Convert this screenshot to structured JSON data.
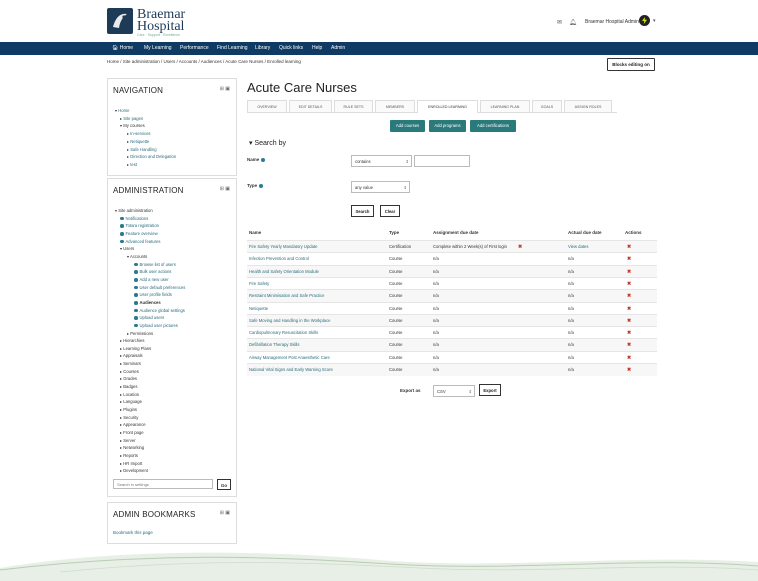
{
  "site": {
    "name_line1": "Braemar",
    "name_line2": "Hospital",
    "tagline": "Care · Support · Excellence"
  },
  "header": {
    "user_name": "Braemar Hospital Admin",
    "mail_icon": "envelope-icon",
    "bell_icon": "bell-icon"
  },
  "nav": {
    "items": [
      "Home",
      "My Learning",
      "Performance",
      "Find Learning",
      "Library",
      "Quick links",
      "Help",
      "Admin"
    ]
  },
  "breadcrumb": "Home / Site administration / Users / Accounts / Audiences / Acute Care Nurses / Enrolled learning",
  "blocks_editing_label": "Blocks editing on",
  "navigation_block": {
    "title": "NAVIGATION",
    "items": [
      "Home",
      "Site pages",
      "My courses",
      "In-services",
      "Netiquette",
      "Safe Handling",
      "Direction and Delegation",
      "test"
    ]
  },
  "admin_block": {
    "title": "ADMINISTRATION",
    "items": [
      "Site administration",
      "Notifications",
      "Totara registration",
      "Feature overview",
      "Advanced features",
      "Users",
      "Accounts",
      "Browse list of users",
      "Bulk user actions",
      "Add a new user",
      "User default preferences",
      "User profile fields",
      "Audiences",
      "Audience global settings",
      "Upload users",
      "Upload user pictures",
      "Permissions",
      "Hierarchies",
      "Learning Plans",
      "Appraisals",
      "Seminars",
      "Courses",
      "Grades",
      "Badges",
      "Location",
      "Language",
      "Plugins",
      "Security",
      "Appearance",
      "Front page",
      "Server",
      "Networking",
      "Reports",
      "HR Import",
      "Development"
    ],
    "search_placeholder": "Search in settings",
    "go_label": "Go"
  },
  "bookmarks_block": {
    "title": "ADMIN BOOKMARKS",
    "link": "Bookmark this page"
  },
  "main": {
    "title": "Acute Care Nurses",
    "tabs": [
      "OVERVIEW",
      "EDIT DETAILS",
      "RULE SETS",
      "MEMBERS",
      "ENROLLED LEARNING",
      "LEARNING PLAN",
      "GOALS",
      "ASSIGN ROLES"
    ],
    "active_tab": "ENROLLED LEARNING",
    "buttons": [
      "Add courses",
      "Add programs",
      "Add certifications"
    ],
    "search_by": "Search by",
    "name_label": "Name",
    "name_operator": "contains",
    "type_label": "Type",
    "type_value": "any value",
    "search_button": "Search",
    "clear_button": "Clear",
    "table": {
      "headers": [
        "Name",
        "Type",
        "Assignment due date",
        "Actual due date",
        "Actions"
      ],
      "rows": [
        [
          "Fire Safety Yearly Mandatory Update",
          "Certification",
          "Complete within 2 Week(s) of First login",
          "View dates"
        ],
        [
          "Infection Prevention and Control",
          "Course",
          "n/a",
          "n/a"
        ],
        [
          "Health and Safety Orientation Module",
          "Course",
          "n/a",
          "n/a"
        ],
        [
          "Fire Safety",
          "Course",
          "n/a",
          "n/a"
        ],
        [
          "Restraint Minimisation and Safe Practice",
          "Course",
          "n/a",
          "n/a"
        ],
        [
          "Netiquette",
          "Course",
          "n/a",
          "n/a"
        ],
        [
          "Safe Moving and Handling in the Workplace",
          "Course",
          "n/a",
          "n/a"
        ],
        [
          "Cardiopulmonary Resuscitation Skills",
          "Course",
          "n/a",
          "n/a"
        ],
        [
          "Defibrillation Therapy Skills",
          "Course",
          "n/a",
          "n/a"
        ],
        [
          "Airway Management Post Anaesthetic Care",
          "Course",
          "n/a",
          "n/a"
        ],
        [
          "National Vital Signs and Early Warning Score",
          "Course",
          "n/a",
          "n/a"
        ]
      ],
      "delete_glyph": "✖"
    },
    "export_label": "Export as",
    "export_format": "CSV",
    "export_button": "Export"
  },
  "colors": {
    "navbar": "#0e3a63",
    "accent": "#2a7a7c",
    "delete": "#c0392b"
  }
}
